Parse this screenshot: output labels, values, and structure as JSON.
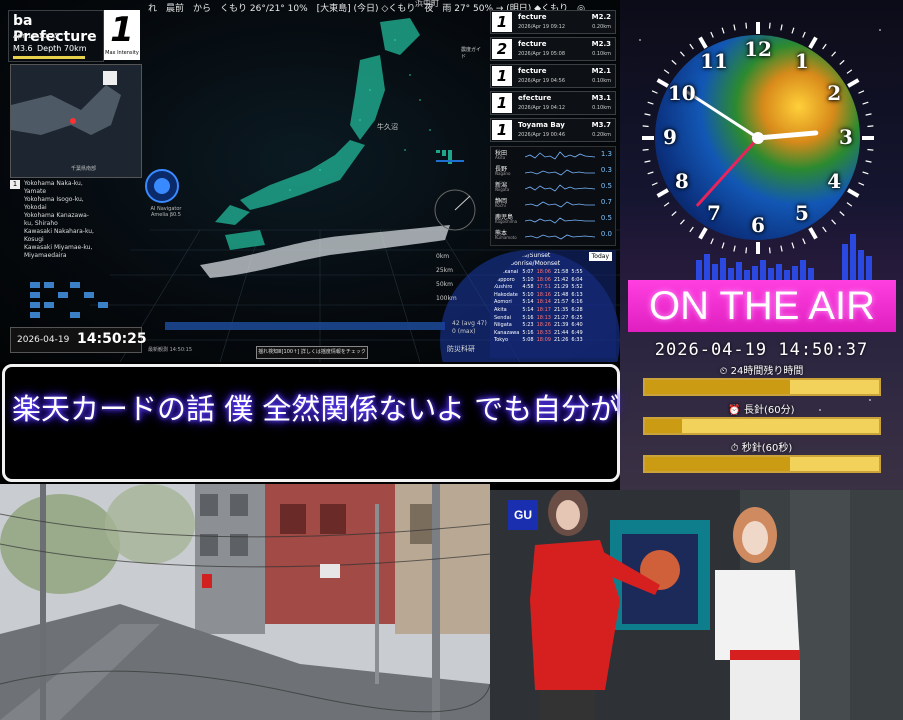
{
  "ticker": {
    "text": "れ　晨前　から　くもり 26°/21° 10%　[大東島] (今日) ◇くもり　夜　雨 27° 50% → (明日) ◆くもり　◎",
    "top_label": "浜中町"
  },
  "prefecture_panel": {
    "name": "ba Prefecture",
    "time": "Apr 19 10:55",
    "magnitude": "M3.6",
    "depth": "Depth 70km",
    "max_intensity": "1",
    "max_intensity_label": "Max Intensity",
    "minimap_label": "千葉県南部"
  },
  "locations": {
    "intensity": "1",
    "list": [
      "Yokohama Naka-ku,",
      "Yamate",
      "Yokohama Isogo-ku,",
      "Yokodai",
      "Yokohama Kanazawa-",
      "ku, Shiraho",
      "Kawasaki Nakahara-ku,",
      "Kosugi",
      "Kawasaki Miyamae-ku,",
      "Miyamaedaira"
    ]
  },
  "clock_box": {
    "date": "2026-04-19",
    "time": "14:50:25"
  },
  "navigator": {
    "label": "AI Navigator Amelia β0.5"
  },
  "map": {
    "label_1": "牛久沼",
    "guide": "震度ガイド",
    "scale": [
      "0km",
      "25km",
      "50km",
      "100km"
    ],
    "bottom_button": "揺れ検知Ⅲ[100↑] 詳しくは揺度情報をチェック",
    "bottom_left": "最新観測 14:50:15",
    "lat": [
      "42 (avg 47)",
      "0 (max)"
    ],
    "bosai": "防災科研"
  },
  "history": [
    {
      "intensity": "1",
      "name": "fecture",
      "date": "2026/Apr 19 09:12",
      "mag": "M2.2",
      "depth": "0.20km"
    },
    {
      "intensity": "2",
      "name": "fecture",
      "date": "2026/Apr 19 05:08",
      "mag": "M2.3",
      "depth": "0.10km"
    },
    {
      "intensity": "1",
      "name": "fecture",
      "date": "2026/Apr 19 04:56",
      "mag": "M2.1",
      "depth": "0.10km"
    },
    {
      "intensity": "1",
      "name": "efecture",
      "date": "2026/Apr 19 04:12",
      "mag": "M3.1",
      "depth": "0.10km"
    },
    {
      "intensity": "1",
      "name": "Toyama Bay",
      "date": "2026/Apr 19 00:46",
      "mag": "M3.7",
      "depth": "0.20km"
    }
  ],
  "seismograph": [
    {
      "name": "秋田",
      "sub": "Akita",
      "value": "1.3"
    },
    {
      "name": "長野",
      "sub": "Nagano",
      "value": "0.3"
    },
    {
      "name": "新潟",
      "sub": "Niigata",
      "value": "0.5"
    },
    {
      "name": "静岡",
      "sub": "Kochi",
      "value": "0.7"
    },
    {
      "name": "鹿児島",
      "sub": "Kagoshima",
      "value": "0.5"
    },
    {
      "name": "熊本",
      "sub": "Kumamoto",
      "value": "0.0"
    }
  ],
  "sunrise": {
    "header_1": "☀ Sunrise/Sunset",
    "header_2": "☾ Moonrise/Moonset",
    "today": "Today",
    "rows": [
      [
        "Wakkanai",
        "5:07",
        "18:06",
        "21:58",
        "5:55"
      ],
      [
        "Sapporo",
        "5:10",
        "18:06",
        "21:42",
        "6:04"
      ],
      [
        "Kushiro",
        "4:58",
        "17:51",
        "21:29",
        "5:52"
      ],
      [
        "Hakodate",
        "5:10",
        "18:16",
        "21:48",
        "6:13"
      ],
      [
        "Aomori",
        "5:14",
        "18:14",
        "21:57",
        "6:16"
      ],
      [
        "Akita",
        "5:14",
        "18:17",
        "21:35",
        "6:28"
      ],
      [
        "Sendai",
        "5:16",
        "18:13",
        "21:27",
        "6:25"
      ],
      [
        "Niigata",
        "5:23",
        "18:26",
        "21:39",
        "6:40"
      ],
      [
        "Kanazawa",
        "5:16",
        "18:33",
        "21:44",
        "6:49"
      ],
      [
        "Tokyo",
        "5:08",
        "18:09",
        "21:26",
        "6:33"
      ]
    ]
  },
  "clock": {
    "numerals": [
      "12",
      "1",
      "2",
      "3",
      "4",
      "5",
      "6",
      "7",
      "8",
      "9",
      "10",
      "11"
    ],
    "hour_deg": 85,
    "minute_deg": 303,
    "second_deg": 222
  },
  "on_air": {
    "label": "ON THE AIR",
    "datetime": "2026-04-19 14:50:37",
    "bars": [
      {
        "label": "⏲ 24時間残り時間",
        "fill": 0.62
      },
      {
        "label": "⏰ 長針(60分)",
        "fill": 0.16
      },
      {
        "label": "⏱ 秒針(60秒)",
        "fill": 0.62
      }
    ],
    "accent": "#ff3fe0"
  },
  "subtitle": {
    "text": "楽天カードの話 僕 全然関係ないよ でも自分が"
  },
  "cameras": {
    "gu_logo": "GU"
  }
}
